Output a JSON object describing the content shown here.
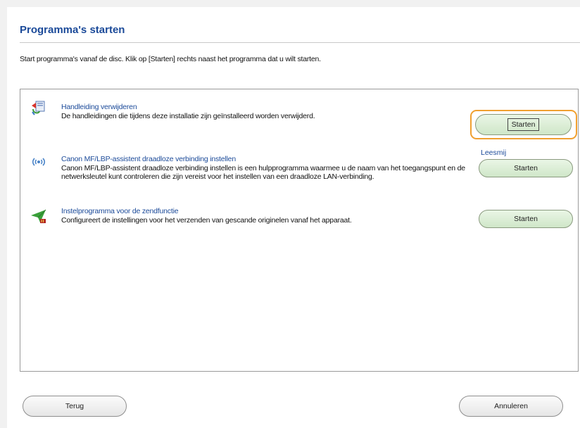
{
  "header": {
    "title": "Programma's starten",
    "intro": "Start programma's vanaf de disc. Klik op [Starten] rechts naast het programma dat u wilt starten."
  },
  "programs": [
    {
      "name": "Handleiding verwijderen",
      "description": "De handleidingen die tijdens deze installatie zijn geïnstalleerd worden verwijderd.",
      "button": "Starten",
      "icon": "uninstall-manual-icon"
    },
    {
      "name": "Canon MF/LBP-assistent draadloze verbinding instellen",
      "description": "Canon MF/LBP-assistent draadloze verbinding instellen is een hulpprogramma waarmee u de naam van het toegangspunt en de netwerksleutel kunt controleren die zijn vereist voor het instellen van een draadloze LAN-verbinding.",
      "button": "Starten",
      "link": "Leesmij",
      "icon": "wireless-signal-icon"
    },
    {
      "name": "Instelprogramma voor de zendfunctie",
      "description": "Configureert de instellingen voor het verzenden van gescande originelen vanaf het apparaat.",
      "button": "Starten",
      "icon": "send-function-icon"
    }
  ],
  "footer": {
    "back": "Terug",
    "cancel": "Annuleren"
  },
  "colors": {
    "title": "#1b4a99",
    "focus": "#f0a030",
    "button_green": "#cfe6c8"
  }
}
